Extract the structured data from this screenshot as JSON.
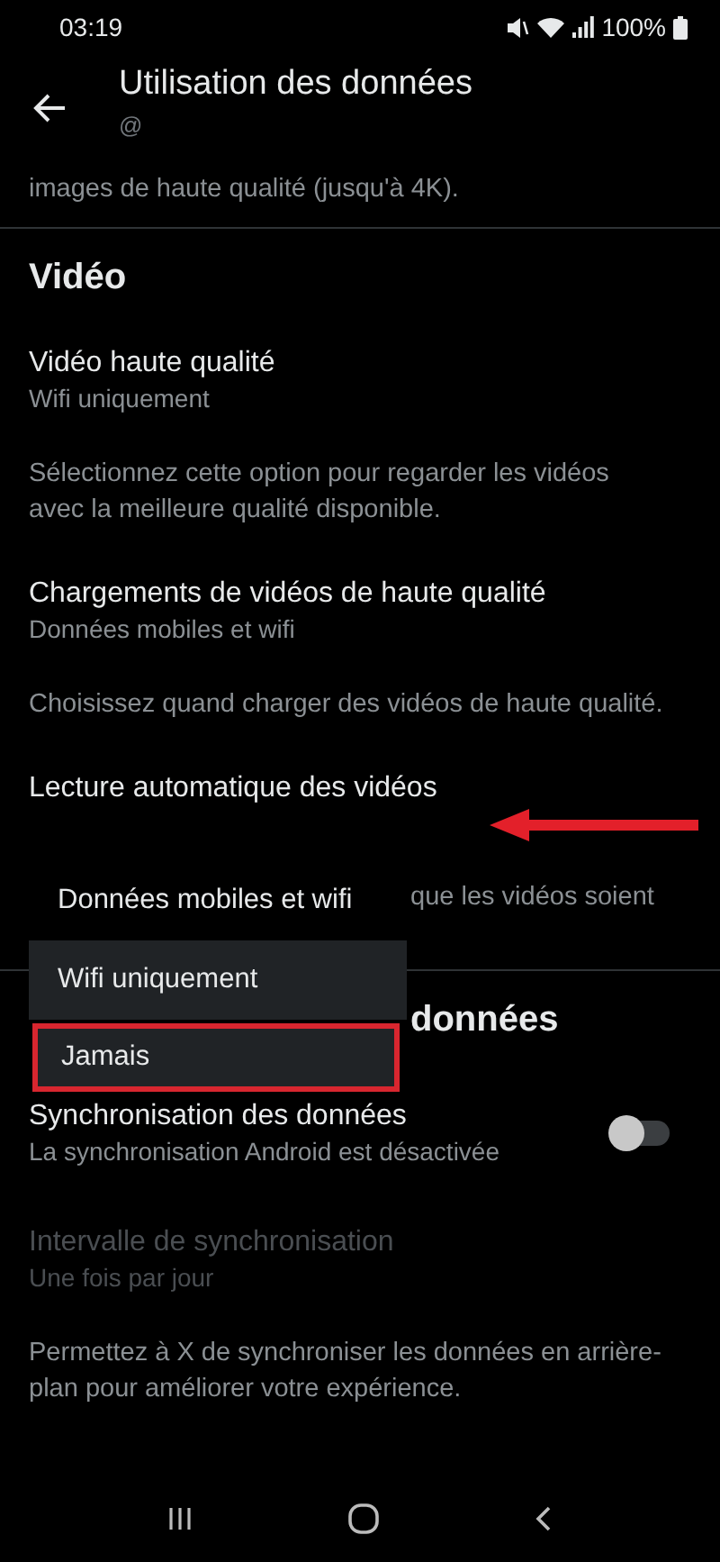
{
  "status_bar": {
    "time": "03:19",
    "battery": "100%"
  },
  "header": {
    "title": "Utilisation des données",
    "subtitle": "@"
  },
  "intro_description": "images de haute qualité (jusqu'à 4K).",
  "sections": [
    {
      "heading": "Vidéo",
      "items": [
        {
          "kind": "option",
          "title": "Vidéo haute qualité",
          "value": "Wifi uniquement",
          "description": "Sélectionnez cette option pour regarder les vidéos avec la meilleure qualité disponible."
        },
        {
          "kind": "option",
          "title": "Chargements de vidéos de haute qualité",
          "value": "Données mobiles et wifi",
          "description": "Choisissez quand charger des vidéos de haute qualité."
        },
        {
          "kind": "option",
          "title": "Lecture automatique des vidéos",
          "description": "que les vidéos soient",
          "annotated": true
        }
      ]
    },
    {
      "heading": "données",
      "items": [
        {
          "kind": "toggle",
          "title": "Synchronisation des données",
          "value": "La synchronisation Android est désactivée",
          "on": false
        },
        {
          "kind": "option",
          "title": "Intervalle de synchronisation",
          "value": "Une fois par jour",
          "disabled": true,
          "description": "Permettez à X de synchroniser les données en arrière-plan pour améliorer votre expérience."
        }
      ]
    }
  ],
  "menu": [
    {
      "label": "Données mobiles et wifi",
      "selected": true,
      "outlined": false
    },
    {
      "label": "Wifi uniquement",
      "selected": false,
      "outlined": false
    },
    {
      "label": "Jamais",
      "selected": false,
      "outlined": true
    }
  ]
}
